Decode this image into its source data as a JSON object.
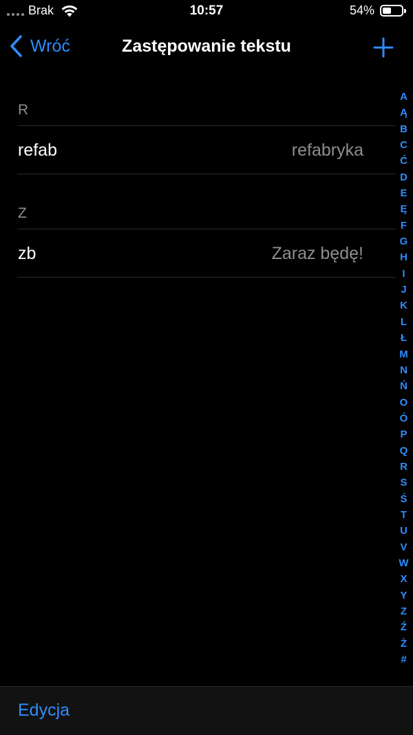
{
  "status_bar": {
    "carrier": "Brak",
    "time": "10:57",
    "battery": "54%",
    "battery_level": 0.54
  },
  "nav": {
    "back_label": "Wróć",
    "title": "Zastępowanie tekstu",
    "add_icon": "plus-icon"
  },
  "sections": [
    {
      "header": "R",
      "items": [
        {
          "phrase": "refab",
          "expansion": "refabryka"
        }
      ]
    },
    {
      "header": "Z",
      "items": [
        {
          "phrase": "zb",
          "expansion": "Zaraz będę!"
        }
      ]
    }
  ],
  "index": [
    "A",
    "Ą",
    "B",
    "C",
    "Ć",
    "D",
    "E",
    "Ę",
    "F",
    "G",
    "H",
    "I",
    "J",
    "K",
    "L",
    "Ł",
    "M",
    "N",
    "Ń",
    "O",
    "Ó",
    "P",
    "Q",
    "R",
    "S",
    "Ś",
    "T",
    "U",
    "V",
    "W",
    "X",
    "Y",
    "Z",
    "Ź",
    "Ż",
    "#"
  ],
  "toolbar": {
    "edit_label": "Edycja"
  },
  "colors": {
    "accent": "#2f8cff",
    "secondary_text": "#8e8e93",
    "background": "#000000"
  }
}
